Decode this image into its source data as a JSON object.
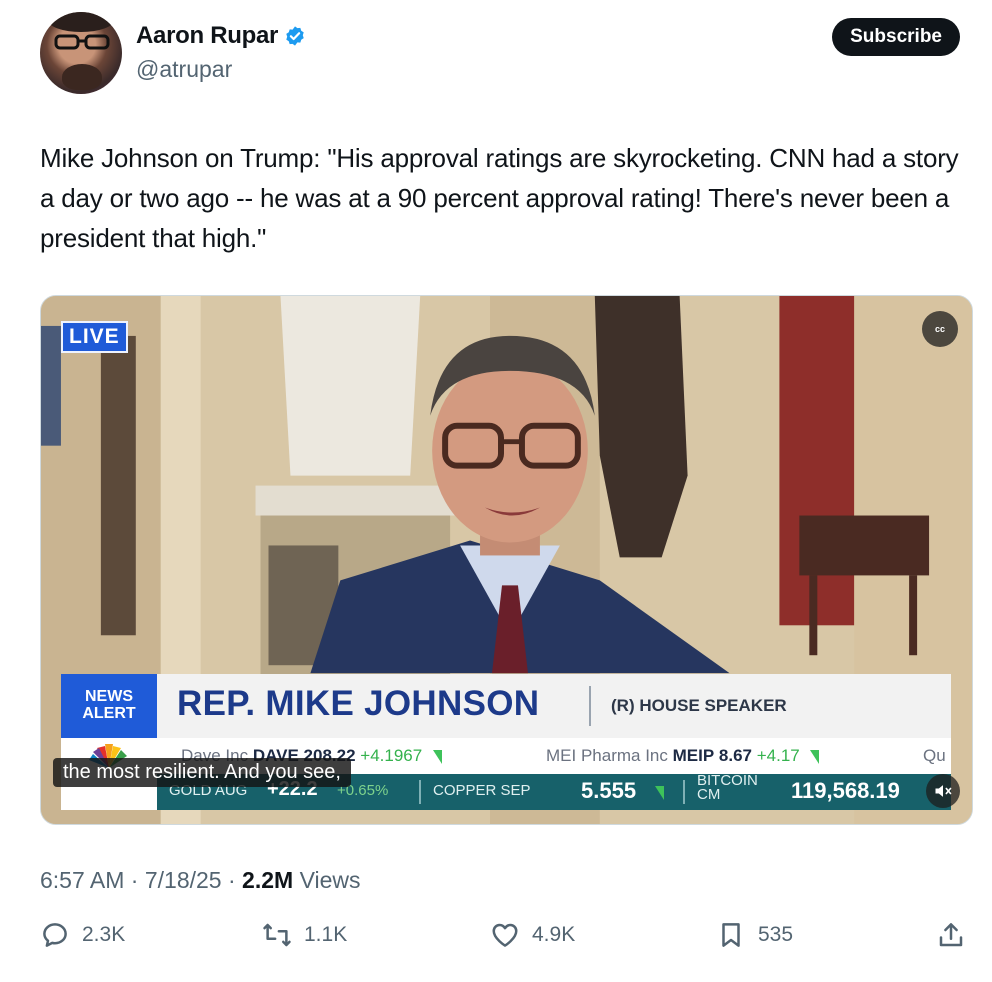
{
  "author": {
    "name": "Aaron Rupar",
    "handle": "@atrupar",
    "subscribe_label": "Subscribe"
  },
  "tweet": {
    "text": "Mike Johnson on Trump: \"His approval ratings are skyrocketing. CNN had a story a day or two ago -- he was at a 90 percent approval rating! There's never been a president that high.\""
  },
  "video": {
    "live_label": "LIVE",
    "cc_label": "cc",
    "news_alert": [
      "NEWS",
      "ALERT"
    ],
    "lower_third_name": "REP. MIKE JOHNSON",
    "lower_third_title": "(R) HOUSE SPEAKER",
    "ticker_top": [
      {
        "company": "Dave Inc",
        "symbol": "DAVE",
        "price": "208.22",
        "change": "+4.1967"
      },
      {
        "company": "MEI Pharma Inc",
        "symbol": "MEIP",
        "price": "8.67",
        "change": "+4.17"
      },
      {
        "company": "Qu",
        "symbol": "",
        "price": "",
        "change": ""
      }
    ],
    "ticker_bottom": [
      {
        "label": "GOLD AUG",
        "value": "+22.2",
        "pct": "+0.65%"
      },
      {
        "label": "COPPER SEP",
        "value": "5.555"
      },
      {
        "label": "BITCOIN CM",
        "value": "119,568.19"
      }
    ],
    "caption": "the most resilient. And you see,"
  },
  "meta": {
    "time": "6:57 AM",
    "date": "7/18/25",
    "views_count": "2.2M",
    "views_label": "Views"
  },
  "actions": {
    "replies": "2.3K",
    "reposts": "1.1K",
    "likes": "4.9K",
    "bookmarks": "535"
  },
  "colors": {
    "verified": "#1d9bf0",
    "text_secondary": "#536471",
    "news_blue": "#1f5bd8",
    "ticker_teal": "#17616a"
  }
}
